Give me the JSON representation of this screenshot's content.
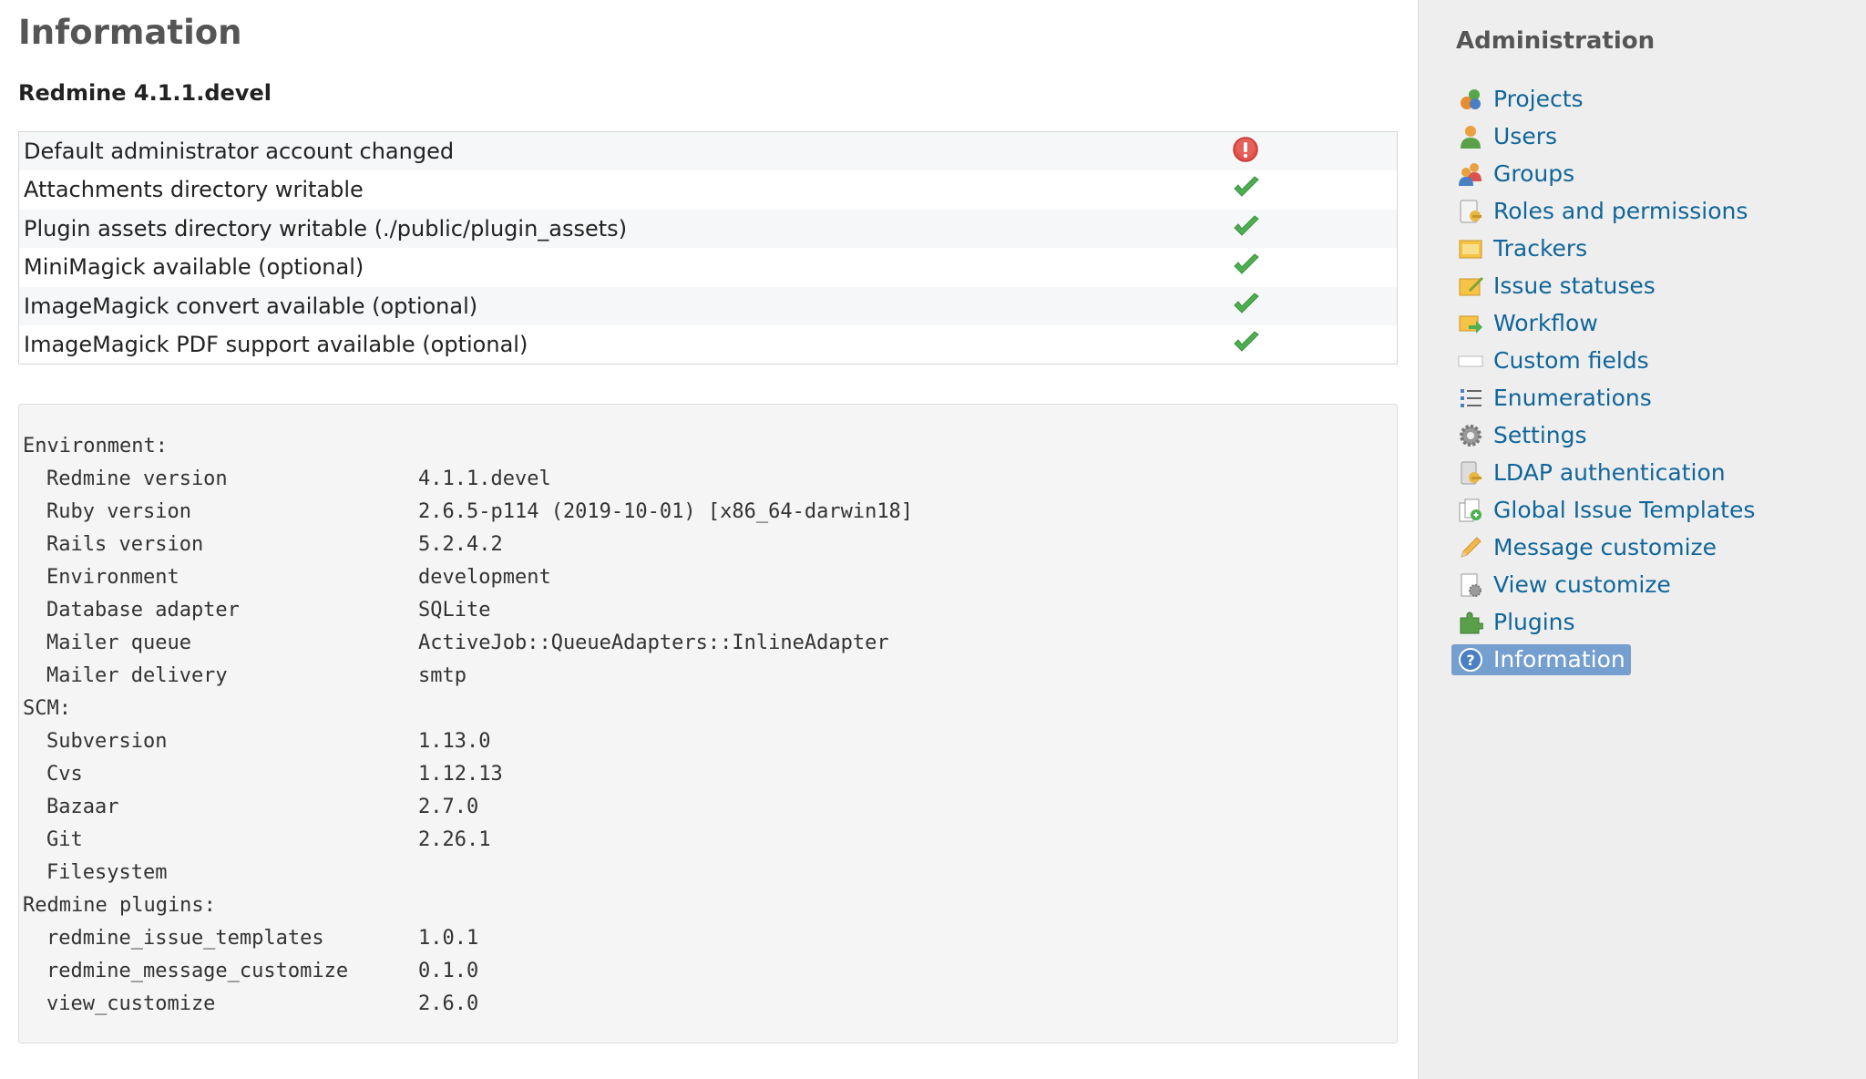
{
  "page": {
    "title": "Information",
    "version_heading": "Redmine 4.1.1.devel"
  },
  "checks": [
    {
      "label": "Default administrator account changed",
      "status": "error",
      "icon": "exclamation-icon"
    },
    {
      "label": "Attachments directory writable",
      "status": "ok",
      "icon": "checkmark-icon"
    },
    {
      "label": "Plugin assets directory writable (./public/plugin_assets)",
      "status": "ok",
      "icon": "checkmark-icon"
    },
    {
      "label": "MiniMagick available (optional)",
      "status": "ok",
      "icon": "checkmark-icon"
    },
    {
      "label": "ImageMagick convert available (optional)",
      "status": "ok",
      "icon": "checkmark-icon"
    },
    {
      "label": "ImageMagick PDF support available (optional)",
      "status": "ok",
      "icon": "checkmark-icon"
    }
  ],
  "environment": {
    "sections": [
      {
        "heading": "Environment:",
        "rows": [
          {
            "key": "Redmine version",
            "value": "4.1.1.devel"
          },
          {
            "key": "Ruby version",
            "value": "2.6.5-p114 (2019-10-01) [x86_64-darwin18]"
          },
          {
            "key": "Rails version",
            "value": "5.2.4.2"
          },
          {
            "key": "Environment",
            "value": "development"
          },
          {
            "key": "Database adapter",
            "value": "SQLite"
          },
          {
            "key": "Mailer queue",
            "value": "ActiveJob::QueueAdapters::InlineAdapter"
          },
          {
            "key": "Mailer delivery",
            "value": "smtp"
          }
        ]
      },
      {
        "heading": "SCM:",
        "rows": [
          {
            "key": "Subversion",
            "value": "1.13.0"
          },
          {
            "key": "Cvs",
            "value": "1.12.13"
          },
          {
            "key": "Bazaar",
            "value": "2.7.0"
          },
          {
            "key": "Git",
            "value": "2.26.1"
          },
          {
            "key": "Filesystem",
            "value": ""
          }
        ]
      },
      {
        "heading": "Redmine plugins:",
        "rows": [
          {
            "key": "redmine_issue_templates",
            "value": "1.0.1"
          },
          {
            "key": "redmine_message_customize",
            "value": "0.1.0"
          },
          {
            "key": "view_customize",
            "value": "2.6.0"
          }
        ]
      }
    ]
  },
  "sidebar": {
    "title": "Administration",
    "items": [
      {
        "label": "Projects",
        "icon": "projects-icon",
        "selected": false
      },
      {
        "label": "Users",
        "icon": "user-icon",
        "selected": false
      },
      {
        "label": "Groups",
        "icon": "group-icon",
        "selected": false
      },
      {
        "label": "Roles and permissions",
        "icon": "roles-icon",
        "selected": false
      },
      {
        "label": "Trackers",
        "icon": "trackers-icon",
        "selected": false
      },
      {
        "label": "Issue statuses",
        "icon": "issue-statuses-icon",
        "selected": false
      },
      {
        "label": "Workflow",
        "icon": "workflow-icon",
        "selected": false
      },
      {
        "label": "Custom fields",
        "icon": "custom-fields-icon",
        "selected": false
      },
      {
        "label": "Enumerations",
        "icon": "list-icon",
        "selected": false
      },
      {
        "label": "Settings",
        "icon": "gear-icon",
        "selected": false
      },
      {
        "label": "LDAP authentication",
        "icon": "ldap-icon",
        "selected": false
      },
      {
        "label": "Global Issue Templates",
        "icon": "template-icon",
        "selected": false
      },
      {
        "label": "Message customize",
        "icon": "pencil-icon",
        "selected": false
      },
      {
        "label": "View customize",
        "icon": "view-customize-icon",
        "selected": false
      },
      {
        "label": "Plugins",
        "icon": "puzzle-icon",
        "selected": false
      },
      {
        "label": "Information",
        "icon": "help-icon",
        "selected": true
      }
    ]
  },
  "colors": {
    "link": "#116699",
    "selected_bg": "#759fcf",
    "ok": "#4caf50",
    "error": "#e0524b",
    "sidebar_bg": "#eeeeee"
  }
}
